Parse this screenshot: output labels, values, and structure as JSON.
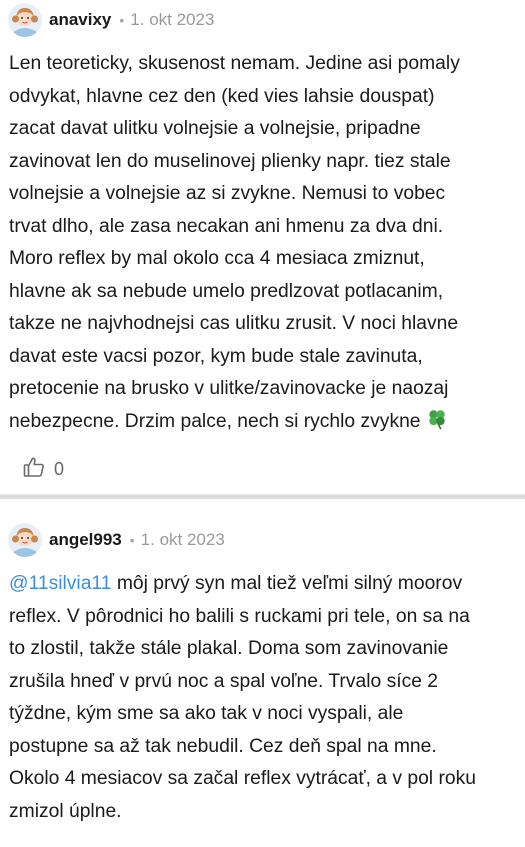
{
  "comments": [
    {
      "username": "anavixy",
      "separator": "•",
      "date": "1. okt 2023",
      "text_lines": [
        "Len teoreticky, skusenost nemam. Jedine asi pomaly",
        "odvykat, hlavne cez den (ked vies lahsie douspat)",
        "zacat davat ulitku volnejsie a volnejsie, pripadne",
        "zavinovat len do muselinovej plienky napr. tiez stale",
        "volnejsie a volnejsie az si zvykne. Nemusi to vobec",
        "trvat dlho, ale zasa necakan ani hmenu za dva dni.",
        "Moro reflex by mal okolo cca 4 mesiaca zmiznut,",
        "hlavne ak sa nebude umelo predlzovat potlacanim,",
        "takze ne najvhodnejsi cas ulitku zrusit. V noci hlavne",
        "davat este vacsi pozor, kym bude stale zavinuta,",
        "pretocenie na brusko v ulitke/zavinovacke je naozaj",
        "nebezpecne. Drzim palce, nech si rychlo zvykne"
      ],
      "emoji_icon": "four-leaf-clover-icon",
      "like_icon": "thumbs-up-icon",
      "like_count": "0"
    },
    {
      "username": "angel993",
      "separator": "•",
      "date": "1. okt 2023",
      "mention": "@11silvia11",
      "text_lines": [
        " môj prvý syn mal tiež veľmi silný moorov",
        "reflex. V pôrodnici ho balili s ruckami pri tele, on sa na",
        "to zlostil, takže stále plakal. Doma som zavinovanie",
        "zrušila hneď v prvú noc a spal voľne. Trvalo síce 2",
        "týždne, kým sme sa ako tak v noci vyspali, ale",
        "postupne sa až tak nebudil. Cez deň spal na mne.",
        "Okolo 4 mesiacov sa začal reflex vytrácať, a v pol roku",
        "zmizol úplne."
      ]
    }
  ],
  "colors": {
    "mention": "#3b8fd9",
    "date": "#9a9a9a",
    "separator": "#dcdcdc",
    "clover": "#4caf50"
  }
}
